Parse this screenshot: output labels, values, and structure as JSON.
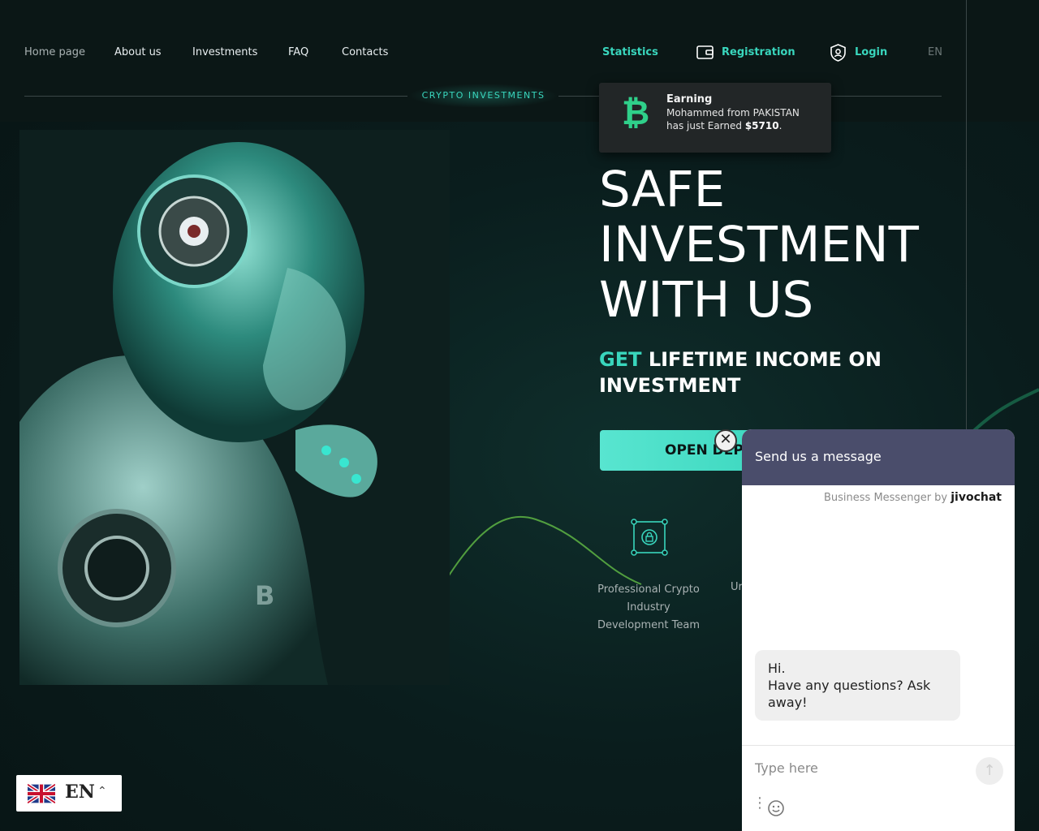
{
  "nav": {
    "home": "Home page",
    "about": "About us",
    "investments": "Investments",
    "faq": "FAQ",
    "contacts": "Contacts",
    "statistics": "Statistics",
    "registration": "Registration",
    "login": "Login",
    "lang": "EN"
  },
  "tag": "CRYPTO INVESTMENTS",
  "notification": {
    "title": "Earning",
    "line1": "Mohammed from PAKISTAN",
    "line2_prefix": "has just Earned ",
    "amount": "$5710",
    "line2_suffix": "."
  },
  "hero": {
    "title_lines": [
      "SAFE",
      "INVESTMENT",
      "WITH US"
    ],
    "sub_accent": "GET",
    "sub_rest": " LIFETIME INCOME ON INVESTMENT",
    "cta": "OPEN DEPOSIT"
  },
  "features": {
    "item1": "Professional Crypto Industry Development Team",
    "item2_partial": "Ur"
  },
  "chat": {
    "header": "Send us a message",
    "brand_prefix": "Business Messenger by ",
    "brand": "jivochat",
    "bubble": "Hi.\nHave any questions? Ask away!",
    "placeholder": "Type here"
  },
  "lang_switch": {
    "code": "EN"
  },
  "colors": {
    "accent": "#39d6bd",
    "bitcoin": "#2fd08a",
    "chat_header": "#4a4d6b"
  }
}
